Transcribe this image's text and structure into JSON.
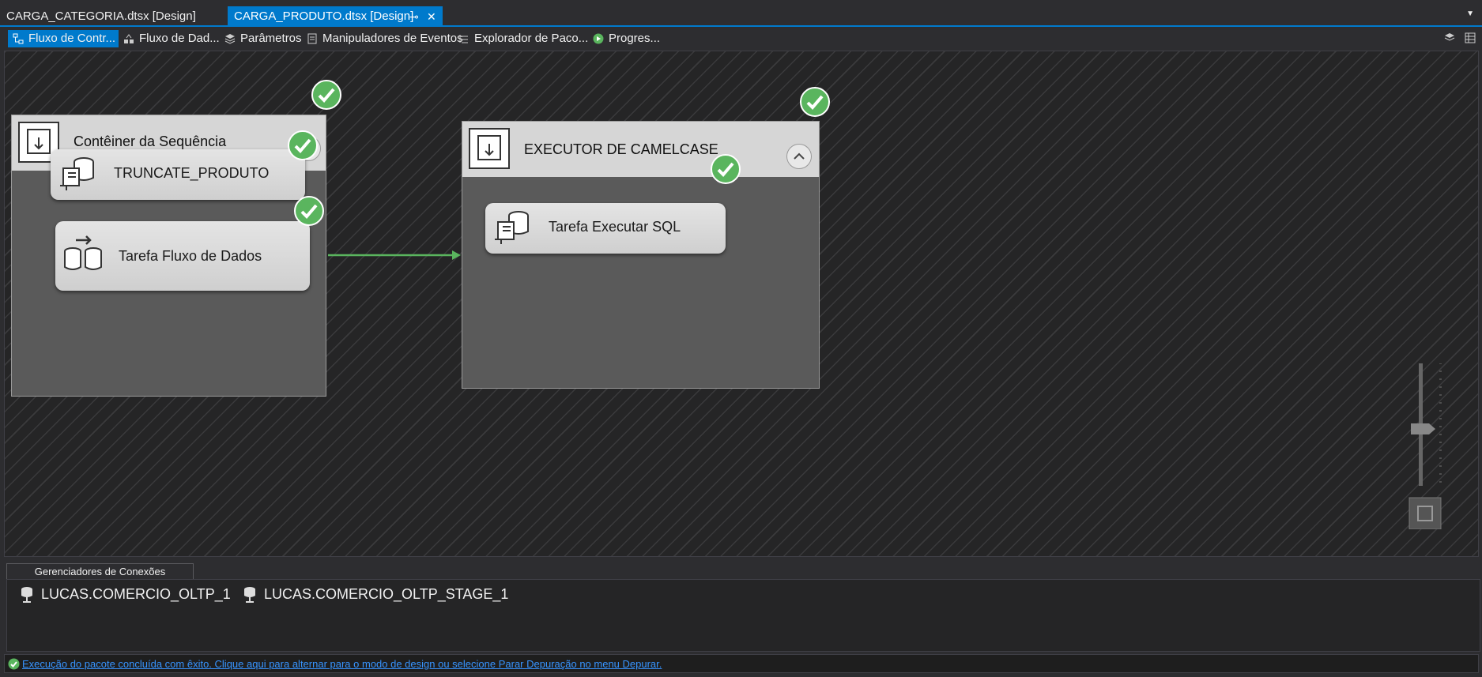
{
  "doc_tabs": [
    {
      "label": "CARGA_CATEGORIA.dtsx [Design]"
    },
    {
      "label": "CARGA_PRODUTO.dtsx [Design]"
    }
  ],
  "designer_tabs": [
    {
      "label": "Fluxo de Contr..."
    },
    {
      "label": "Fluxo de Dad..."
    },
    {
      "label": "Parâmetros"
    },
    {
      "label": "Manipuladores de Eventos"
    },
    {
      "label": "Explorador de Paco..."
    },
    {
      "label": "Progres..."
    }
  ],
  "canvas": {
    "container1": {
      "title": "Contêiner da Sequência",
      "tasks": [
        "TRUNCATE_PRODUTO",
        "Tarefa Fluxo de Dados"
      ]
    },
    "container2": {
      "title": "EXECUTOR DE CAMELCASE",
      "tasks": [
        "Tarefa Executar SQL"
      ]
    }
  },
  "connections": {
    "tab_label": "Gerenciadores de Conexões",
    "items": [
      "LUCAS.COMERCIO_OLTP_1",
      "LUCAS.COMERCIO_OLTP_STAGE_1"
    ]
  },
  "status": {
    "message": "Execução do pacote concluída com êxito. Clique aqui para alternar para o modo de design ou selecione Parar Depuração no menu Depurar."
  },
  "colors": {
    "accent": "#007acc",
    "success": "#5ab55e",
    "link": "#3794ff"
  }
}
